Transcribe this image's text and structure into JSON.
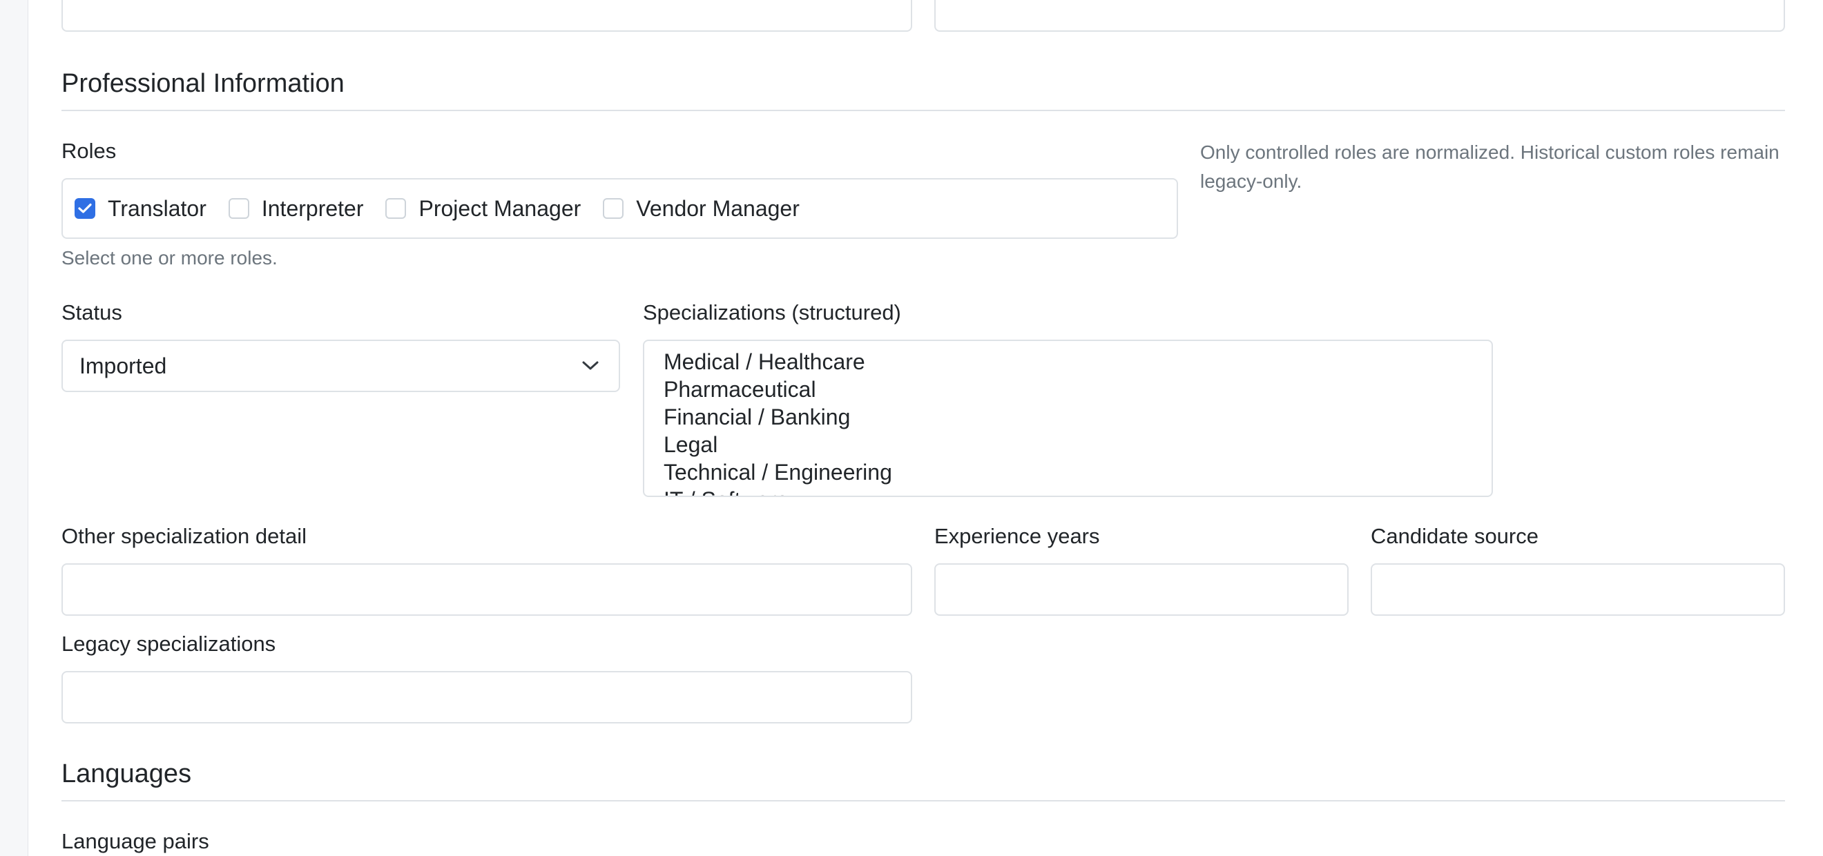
{
  "professional": {
    "section_title": "Professional Information",
    "roles_label": "Roles",
    "roles": [
      {
        "label": "Translator",
        "checked": true
      },
      {
        "label": "Interpreter",
        "checked": false
      },
      {
        "label": "Project Manager",
        "checked": false
      },
      {
        "label": "Vendor Manager",
        "checked": false
      }
    ],
    "roles_help": "Select one or more roles.",
    "roles_note": "Only controlled roles are normalized. Historical custom roles remain legacy-only.",
    "status_label": "Status",
    "status_value": "Imported",
    "specializations_label": "Specializations (structured)",
    "specializations_options": [
      "Medical / Healthcare",
      "Pharmaceutical",
      "Financial / Banking",
      "Legal",
      "Technical / Engineering",
      "IT / Software"
    ],
    "other_specialization_label": "Other specialization detail",
    "other_specialization_value": "",
    "experience_years_label": "Experience years",
    "experience_years_value": "",
    "candidate_source_label": "Candidate source",
    "candidate_source_value": "",
    "legacy_specializations_label": "Legacy specializations",
    "legacy_specializations_value": ""
  },
  "languages": {
    "section_title": "Languages",
    "language_pairs_label": "Language pairs"
  },
  "colors": {
    "accent": "#2f6fe4",
    "border": "#dee2e6",
    "muted_text": "#6c757d"
  }
}
